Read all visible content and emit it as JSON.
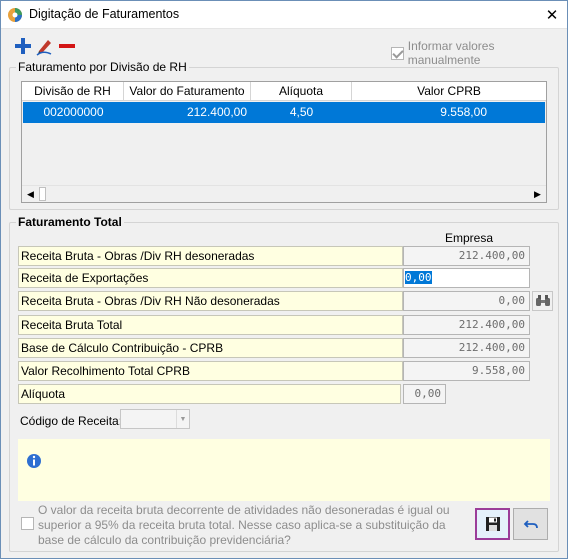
{
  "window": {
    "title": "Digitação de Faturamentos",
    "close_glyph": "✕"
  },
  "toolbar": {
    "add_icon": "plus-icon",
    "edit_icon": "pencil-icon",
    "remove_icon": "minus-icon",
    "manual_label": "Informar valores manualmente",
    "manual_checked": true
  },
  "rh_group": {
    "label": "Faturamento por Divisão de RH",
    "columns": [
      "Divisão de RH",
      "Valor do Faturamento",
      "Alíquota",
      "Valor CPRB"
    ],
    "rows": [
      {
        "divisao": "002000000",
        "valor": "212.400,00",
        "aliquota": "4,50",
        "cprb": "9.558,00"
      }
    ],
    "scroll_left": "◀",
    "scroll_right": "▶"
  },
  "total_group": {
    "label": "Faturamento Total",
    "column_header": "Empresa",
    "rows": {
      "r1": {
        "label": "Receita Bruta - Obras /Div RH desoneradas",
        "value": "212.400,00"
      },
      "r2": {
        "label": "Receita de Exportações",
        "value": "0,00"
      },
      "r3": {
        "label": "Receita Bruta - Obras /Div RH Não desoneradas",
        "value": "0,00"
      },
      "r4": {
        "label": "Receita Bruta Total",
        "value": "212.400,00"
      },
      "r5": {
        "label": "Base de Cálculo Contribuição - CPRB",
        "value": "212.400,00"
      },
      "r6": {
        "label": "Valor Recolhimento Total CPRB",
        "value": "9.558,00"
      },
      "r7": {
        "label": "Alíquota",
        "value": "0,00"
      }
    },
    "codigo_label": "Código de Receita:",
    "codigo_value": "",
    "combo_arrow": "▼",
    "lookup_icon": "binoculars-icon",
    "info_icon": "info-icon"
  },
  "footer": {
    "checkbox_text": "O valor da receita bruta decorrente de atividades não desoneradas é igual ou superior a 95% da receita bruta total. Nesse caso aplica-se a substituição da base de cálculo da contribuição previdenciária?",
    "save_icon": "save-icon",
    "undo_icon": "undo-icon"
  },
  "colors": {
    "selection": "#0078d7",
    "label_bg": "#ffffe1",
    "save_focus": "#9b3c99",
    "add": "#1f5fbf",
    "remove": "#d31515"
  }
}
